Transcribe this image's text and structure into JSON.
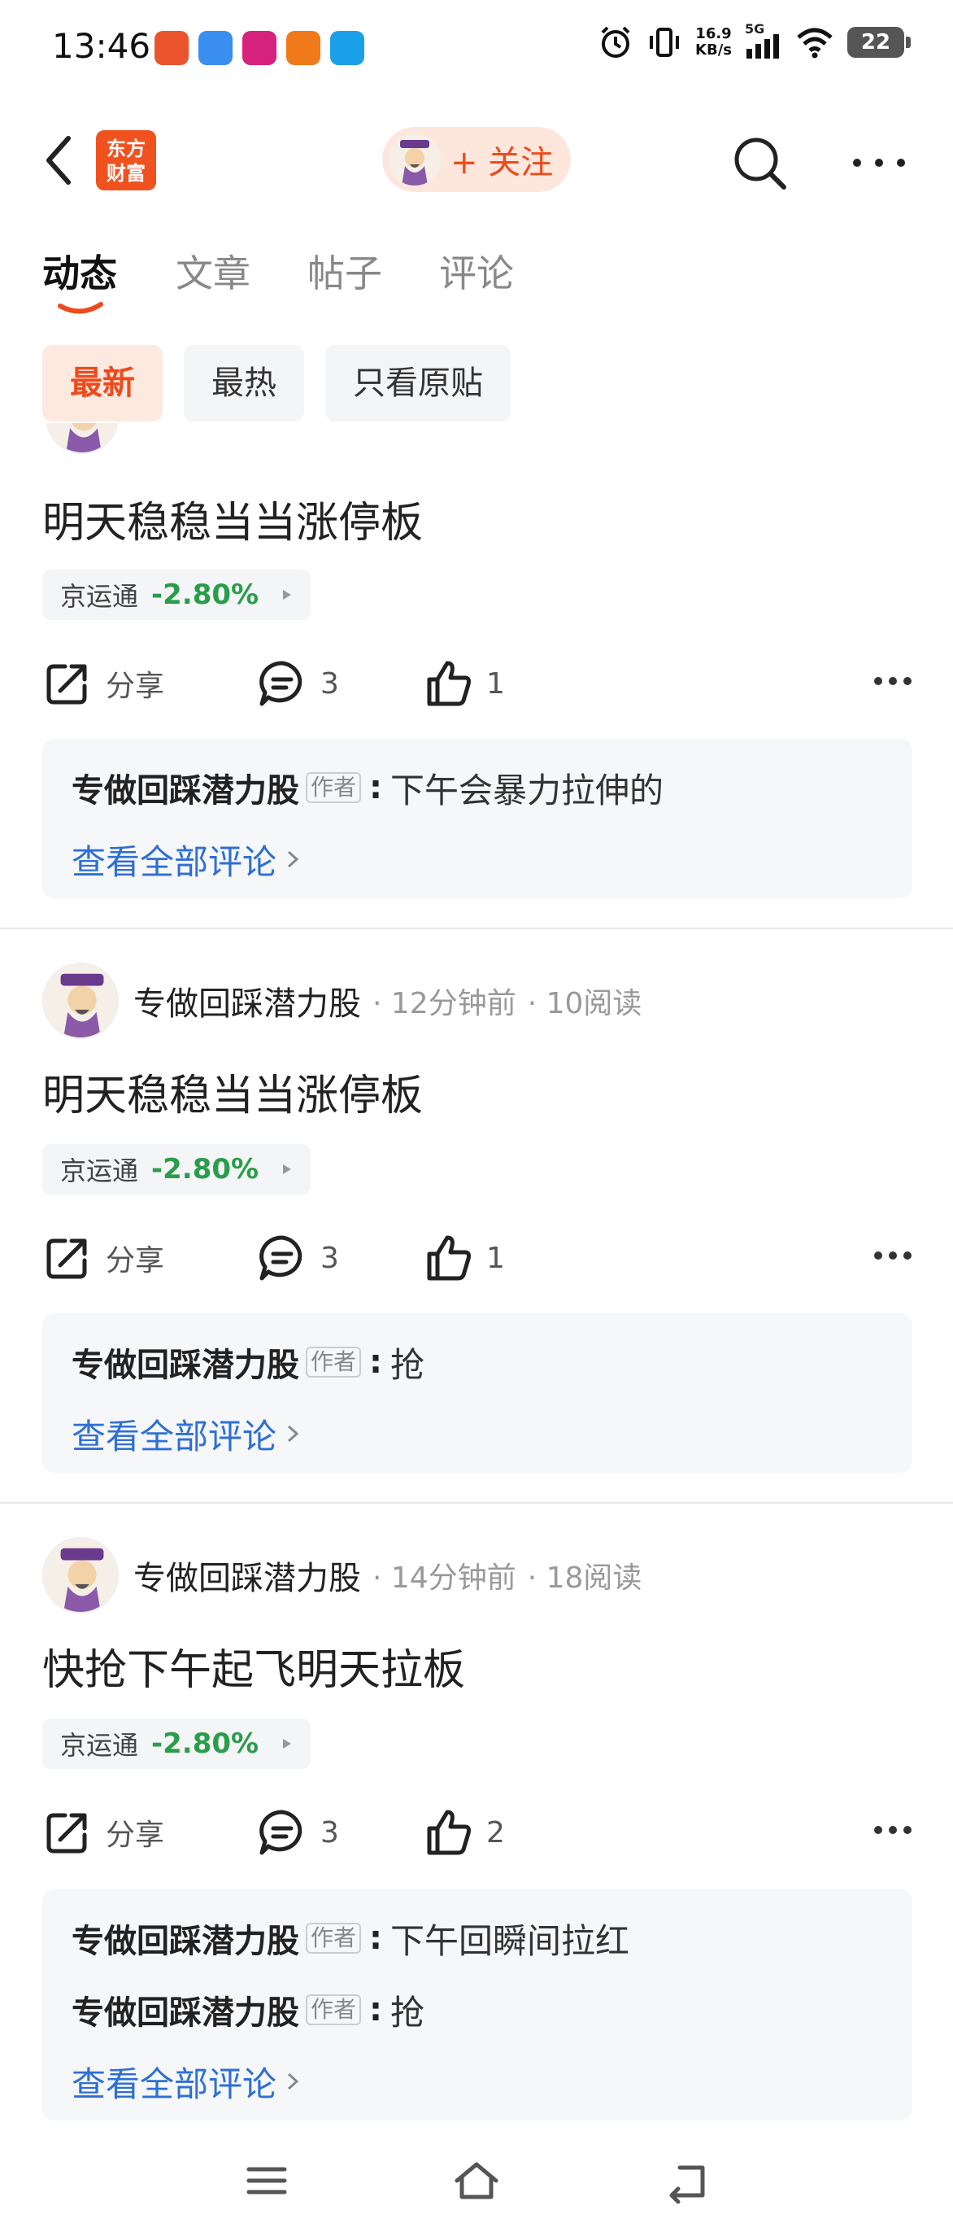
{
  "status": {
    "time": "13:46",
    "net_speed_top": "16.9",
    "net_speed_bottom": "KB/s",
    "signal": "5G",
    "battery": "22"
  },
  "header": {
    "brand_logo_line1": "东方",
    "brand_logo_line2": "财富",
    "follow_label": "+ 关注"
  },
  "tabs": [
    {
      "label": "动态",
      "active": true
    },
    {
      "label": "文章"
    },
    {
      "label": "帖子"
    },
    {
      "label": "评论"
    }
  ],
  "filters": [
    {
      "label": "最新",
      "active": true
    },
    {
      "label": "最热"
    },
    {
      "label": "只看原贴"
    }
  ],
  "posts": [
    {
      "title": "明天稳稳当当涨停板",
      "stock": {
        "name": "京运通",
        "change": "-2.80%"
      },
      "actions": {
        "share": "分享",
        "comments": "3",
        "likes": "1"
      },
      "comments": [
        {
          "author": "专做回踩潜力股",
          "tag": "作者",
          "text": "下午会暴力拉伸的"
        }
      ],
      "see_all": "查看全部评论"
    },
    {
      "author": "专做回踩潜力股",
      "time": "· 12分钟前",
      "reads": "· 10阅读",
      "title": "明天稳稳当当涨停板",
      "stock": {
        "name": "京运通",
        "change": "-2.80%"
      },
      "actions": {
        "share": "分享",
        "comments": "3",
        "likes": "1"
      },
      "comments": [
        {
          "author": "专做回踩潜力股",
          "tag": "作者",
          "text": "抢"
        }
      ],
      "see_all": "查看全部评论"
    },
    {
      "author": "专做回踩潜力股",
      "time": "· 14分钟前",
      "reads": "· 18阅读",
      "title": "快抢下午起飞明天拉板",
      "stock": {
        "name": "京运通",
        "change": "-2.80%"
      },
      "actions": {
        "share": "分享",
        "comments": "3",
        "likes": "2"
      },
      "comments": [
        {
          "author": "专做回踩潜力股",
          "tag": "作者",
          "text": "下午回瞬间拉红"
        },
        {
          "author": "专做回踩潜力股",
          "tag": "作者",
          "text": "抢"
        }
      ],
      "see_all": "查看全部评论"
    }
  ],
  "colors": {
    "accent": "#ef4a1c",
    "stock_down": "#2a9d4b",
    "link": "#2e6fd4"
  }
}
